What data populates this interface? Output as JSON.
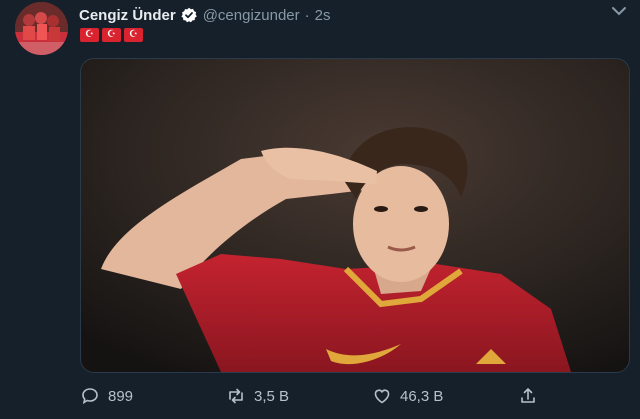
{
  "tweet": {
    "display_name": "Cengiz Ünder",
    "handle": "@cengizunder",
    "separator": "·",
    "time": "2s",
    "flags": [
      "☪",
      "☪",
      "☪"
    ],
    "media": {
      "description": "Player in a red jersey saluting"
    }
  },
  "actions": {
    "reply_count": "899",
    "retweet_count": "3,5 B",
    "like_count": "46,3 B"
  },
  "colors": {
    "background": "#15202b",
    "jersey_red": "#b8202b",
    "verified_blue": "#ffffff"
  }
}
